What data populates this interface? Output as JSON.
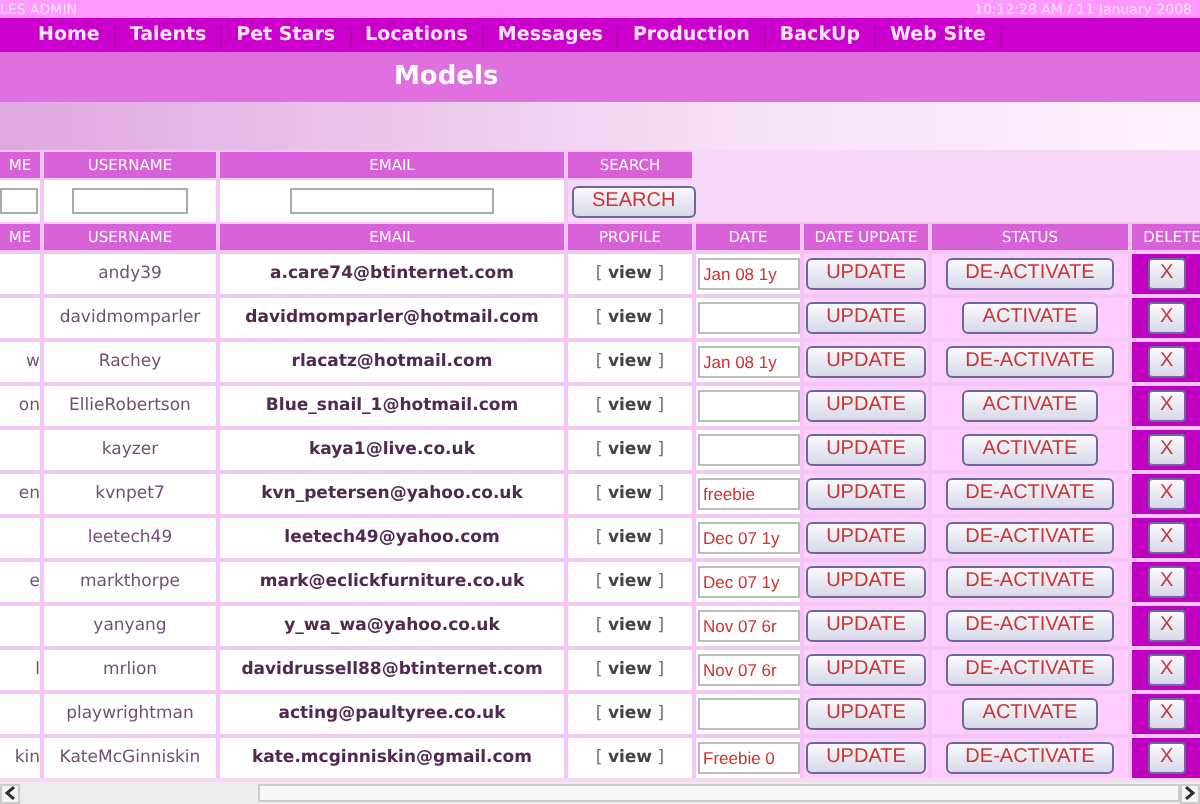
{
  "header": {
    "title_fragment": "LES ADMIN",
    "datetime": "10:12:28 AM / 11 January 2008"
  },
  "nav": [
    "Home",
    "Talents",
    "Pet Stars",
    "Locations",
    "Messages",
    "Production",
    "BackUp",
    "Web Site"
  ],
  "page_title": "Models",
  "search": {
    "columns": [
      "ME",
      "USERNAME",
      "EMAIL",
      "SEARCH"
    ],
    "button": "SEARCH"
  },
  "table": {
    "columns": [
      "ME",
      "USERNAME",
      "EMAIL",
      "PROFILE",
      "DATE",
      "DATE UPDATE",
      "STATUS",
      "DELETE"
    ],
    "rows": [
      {
        "username": "andy39",
        "email": "a.care74@btinternet.com",
        "profile": "[ **view** ]",
        "date": "Jan 08 1y",
        "update": "UPDATE",
        "status": "DE-ACTIVATE",
        "delete": "X"
      },
      {
        "username": "davidmomparler",
        "email": "davidmomparler@hotmail.com",
        "profile": "[ **view** ]",
        "update": "UPDATE",
        "status": "ACTIVATE",
        "delete": "X"
      },
      {
        "column_1": "w",
        "username": "Rachey",
        "email": "rlacatz@hotmail.com",
        "profile": "[ **view** ]",
        "date": "Jan 08 1y",
        "update": "UPDATE",
        "status": "DE-ACTIVATE",
        "delete": "X"
      },
      {
        "column_1": "on",
        "username": "EllieRobertson",
        "email": "Blue_snail_1@hotmail.com",
        "profile": "[ **view** ]",
        "update": "UPDATE",
        "status": "ACTIVATE",
        "delete": "X"
      },
      {
        "username": "kayzer",
        "email": "kaya1@live.co.uk",
        "profile": "[ **view** ]",
        "update": "UPDATE",
        "status": "ACTIVATE",
        "delete": "X"
      },
      {
        "column_1": "en",
        "username": "kvnpet7",
        "email": "kvn_petersen@yahoo.co.uk",
        "profile": "[ **view** ]",
        "date": "freebie",
        "update": "UPDATE",
        "status": "DE-ACTIVATE",
        "delete": "X"
      },
      {
        "username": "leetech49",
        "email": "leetech49@yahoo.com",
        "profile": "[ **view** ]",
        "date": "Dec 07 1y",
        "update": "UPDATE",
        "status": "DE-ACTIVATE",
        "delete": "X"
      },
      {
        "column_1": "e",
        "username": "markthorpe",
        "email": "mark@eclickfurniture.co.uk",
        "profile": "[ **view** ]",
        "date": "Dec 07 1y",
        "update": "UPDATE",
        "status": "DE-ACTIVATE",
        "delete": "X"
      },
      {
        "username": "yanyang",
        "email": "y_wa_wa@yahoo.co.uk",
        "profile": "[ **view** ]",
        "date": "Nov 07 6r",
        "update": "UPDATE",
        "status": "DE-ACTIVATE",
        "delete": "X"
      },
      {
        "column_1": "l",
        "username": "mrlion",
        "email": "davidrussell88@btinternet.com",
        "profile": "[ **view** ]",
        "date": "Nov 07 6r",
        "update": "UPDATE",
        "status": "DE-ACTIVATE",
        "delete": "X"
      },
      {
        "username": "playwrightman",
        "email": "acting@paultyree.co.uk",
        "profile": "[ **view** ]",
        "update": "UPDATE",
        "status": "ACTIVATE",
        "delete": "X"
      },
      {
        "column_1": "kin",
        "username": "KateMcGinniskin",
        "email": "kate.mcginniskin@gmail.com",
        "profile": "[ **view** ]",
        "date": "Freebie 0",
        "update": "UPDATE",
        "status": "DE-ACTIVATE",
        "delete": "X"
      }
    ]
  }
}
